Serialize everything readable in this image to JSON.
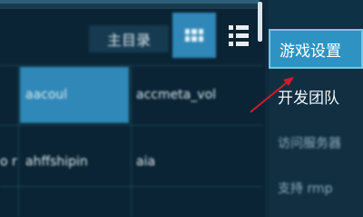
{
  "toolbar": {
    "home_label": "主目录",
    "grid_view_icon": "grid-icon",
    "list_view_icon": "list-icon"
  },
  "table": {
    "rows": [
      {
        "left": "",
        "c1": "aacoul",
        "c2": "accmeta_vol"
      },
      {
        "left": "o r",
        "c1": "ahffshipin",
        "c2": "aia"
      }
    ]
  },
  "side_menu": {
    "items": [
      {
        "label": "游戏设置",
        "active": true
      },
      {
        "label": "开发团队",
        "active": false
      },
      {
        "label": "访问服务器",
        "active": false
      },
      {
        "label": "支持 rmp",
        "active": false
      }
    ]
  },
  "colors": {
    "accent": "#2e93c3",
    "selected_cell": "#2f88b8",
    "arrow": "#d11c2a"
  }
}
